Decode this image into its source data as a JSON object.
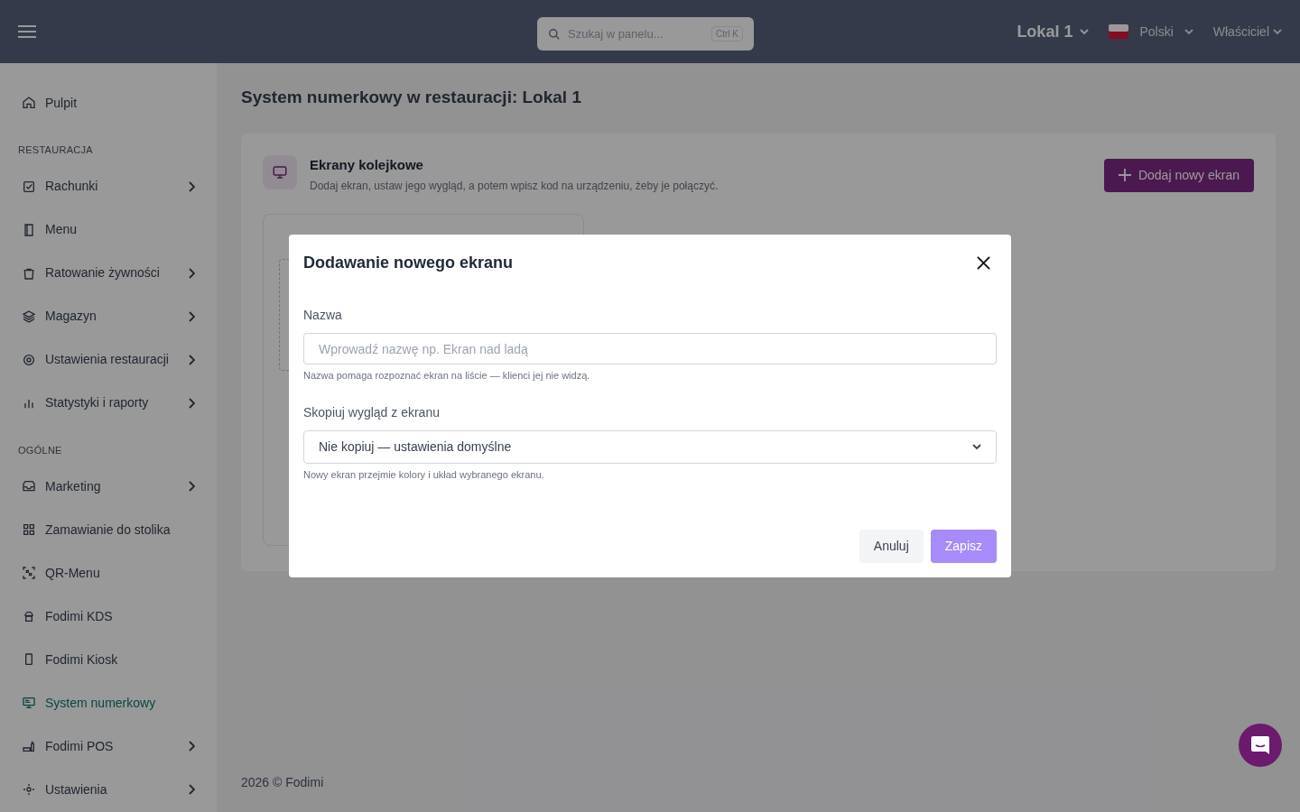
{
  "header": {
    "search_placeholder": "Szukaj w panelu...",
    "search_shortcut": "Ctrl K",
    "location": "Lokal 1",
    "language": "Polski",
    "user": "Właściciel"
  },
  "sidebar": {
    "sections": [
      {
        "items": [
          {
            "label": "Pulpit",
            "has_submenu": false,
            "selected": false
          }
        ]
      },
      {
        "heading": "RESTAURACJA",
        "items": [
          {
            "label": "Rachunki",
            "has_submenu": true,
            "selected": false
          },
          {
            "label": "Menu",
            "has_submenu": false,
            "selected": false
          },
          {
            "label": "Ratowanie żywności",
            "has_submenu": true,
            "selected": false
          },
          {
            "label": "Magazyn",
            "has_submenu": true,
            "selected": false
          },
          {
            "label": "Ustawienia restauracji",
            "has_submenu": true,
            "selected": false
          },
          {
            "label": "Statystyki i raporty",
            "has_submenu": true,
            "selected": false
          }
        ]
      },
      {
        "heading": "OGÓLNE",
        "items": [
          {
            "label": "Marketing",
            "has_submenu": true,
            "selected": false
          },
          {
            "label": "Zamawianie do stolika",
            "has_submenu": false,
            "selected": false
          },
          {
            "label": "QR-Menu",
            "has_submenu": false,
            "selected": false
          },
          {
            "label": "Fodimi KDS",
            "has_submenu": false,
            "selected": false
          },
          {
            "label": "Fodimi Kiosk",
            "has_submenu": false,
            "selected": false
          },
          {
            "label": "System numerkowy",
            "has_submenu": false,
            "selected": true
          },
          {
            "label": "Fodimi POS",
            "has_submenu": true,
            "selected": false
          },
          {
            "label": "Ustawienia",
            "has_submenu": true,
            "selected": false
          }
        ]
      }
    ]
  },
  "page_title": "System numerkowy w restauracji: Lokal 1",
  "card": {
    "title": "Ekrany kolejkowe",
    "description": "Dodaj ekran, ustaw jego wygląd, a potem wpisz kod na urządzeniu, żeby je połączyć.",
    "button": "Dodaj nowy ekran"
  },
  "modal": {
    "title": "Dodawanie nowego ekranu",
    "fields": [
      {
        "kind": "text",
        "label": "Nazwa",
        "placeholder": "Wprowadź nazwę np. Ekran nad ladą",
        "hint": "Nazwa pomaga rozpoznać ekran na liście — klienci jej nie widzą."
      },
      {
        "kind": "select",
        "label": "Skopiuj wygląd z ekranu",
        "value": "Nie kopiuj — ustawienia domyślne",
        "hint": "Nowy ekran przejmie kolory i układ wybranego ekranu."
      }
    ],
    "cancel": "Anuluj",
    "save": "Zapisz"
  },
  "footer": "2026 © Fodimi"
}
